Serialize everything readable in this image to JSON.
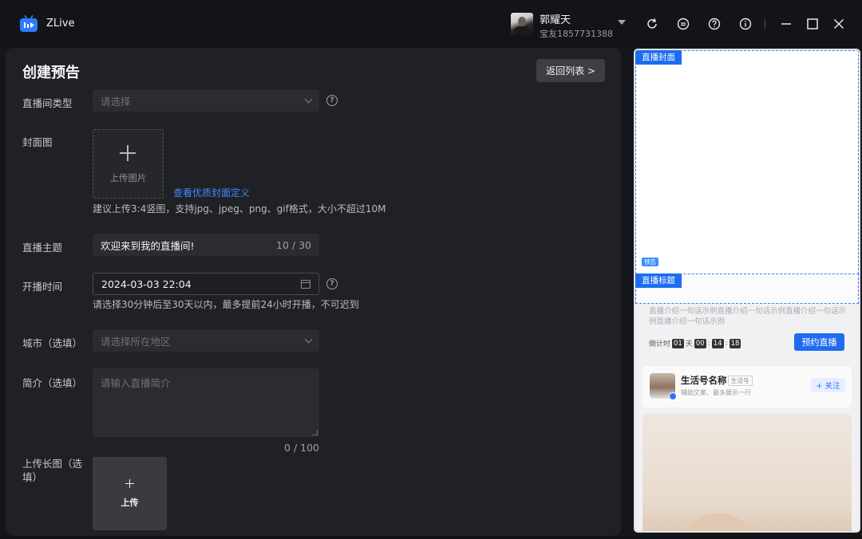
{
  "window": {
    "app_name": "ZLive",
    "user_name": "郭耀天",
    "user_sub": "宝友1857731388",
    "toolbar_icons": [
      "refresh-icon",
      "message-icon",
      "help-icon",
      "info-icon",
      "minimize-icon",
      "maximize-icon",
      "close-icon"
    ]
  },
  "form": {
    "title": "创建预告",
    "back_button": "返回列表 >",
    "room_type": {
      "label": "直播间类型",
      "placeholder": "请选择"
    },
    "cover": {
      "label": "封面图",
      "upload_text": "上传图片",
      "link": "查看优质封面定义",
      "hint": "建议上传3:4竖图，支持jpg、jpeg、png、gif格式，大小不超过10M"
    },
    "topic": {
      "label": "直播主题",
      "value": "欢迎来到我的直播间!",
      "counter": "10 / 30"
    },
    "start_time": {
      "label": "开播时间",
      "value": "2024-03-03 22:04",
      "hint": "请选择30分钟后至30天以内，最多提前24小时开播，不可迟到"
    },
    "city": {
      "label": "城市（选填）",
      "placeholder": "请选择所在地区"
    },
    "intro": {
      "label": "简介（选填）",
      "placeholder": "请输入直播简介",
      "counter": "0 / 100"
    },
    "long_image": {
      "label": "上传长图（选填）",
      "upload_text": "上传"
    }
  },
  "preview": {
    "cover_tag": "直播封面",
    "preview_tag": "预告",
    "title_tag": "直播标题",
    "desc": "直播介绍一句话示例直播介绍一句话示例直播介绍一句话示例直播介绍一句话示例",
    "countdown": {
      "prefix": "倒计时",
      "days": "01",
      "day_unit": "天",
      "hours": "00",
      "minutes": "14",
      "seconds": "18"
    },
    "reserve_button": "预约直播",
    "account": {
      "name": "生活号名称",
      "badge": "生活号",
      "sub": "辅助文案、最多展示一行",
      "follow": "+ 关注"
    }
  },
  "colors": {
    "accent": "#1f6cf0",
    "link": "#3b8bff",
    "panel": "#202125",
    "field": "#2b2c31"
  }
}
